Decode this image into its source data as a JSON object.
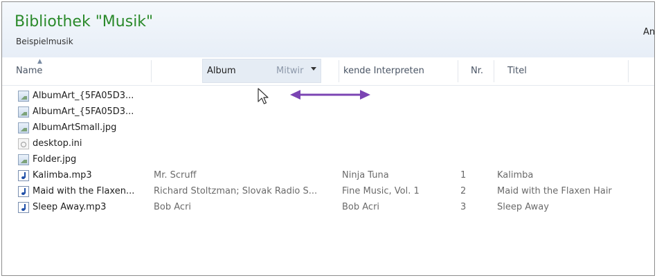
{
  "header": {
    "title": "Bibliothek \"Musik\"",
    "subtitle": "Beispielmusik",
    "arrange_cut": "An"
  },
  "columns": {
    "name": "Name",
    "album": "Album",
    "mitwirkende_partial": "Mitwir",
    "mitwirkende_rest": "kende Interpreten",
    "nr": "Nr.",
    "titel": "Titel"
  },
  "files": [
    {
      "name": "AlbumArt_{5FA05D3...",
      "icon": "image-file-icon",
      "artist": "",
      "album": "",
      "nr": "",
      "title": ""
    },
    {
      "name": "AlbumArt_{5FA05D3...",
      "icon": "image-file-icon",
      "artist": "",
      "album": "",
      "nr": "",
      "title": ""
    },
    {
      "name": "AlbumArtSmall.jpg",
      "icon": "image-file-icon",
      "artist": "",
      "album": "",
      "nr": "",
      "title": ""
    },
    {
      "name": "desktop.ini",
      "icon": "settings-file-icon",
      "artist": "",
      "album": "",
      "nr": "",
      "title": ""
    },
    {
      "name": "Folder.jpg",
      "icon": "image-file-icon",
      "artist": "",
      "album": "",
      "nr": "",
      "title": ""
    },
    {
      "name": "Kalimba.mp3",
      "icon": "audio-file-icon",
      "artist": "Mr. Scruff",
      "album": "Ninja Tuna",
      "nr": "1",
      "title": "Kalimba"
    },
    {
      "name": "Maid with the Flaxen...",
      "icon": "audio-file-icon",
      "artist": "Richard Stoltzman; Slovak Radio S...",
      "album": "Fine Music, Vol. 1",
      "nr": "2",
      "title": "Maid with the Flaxen Hair"
    },
    {
      "name": "Sleep Away.mp3",
      "icon": "audio-file-icon",
      "artist": "Bob Acri",
      "album": "Bob Acri",
      "nr": "3",
      "title": "Sleep Away"
    }
  ],
  "colors": {
    "title_green": "#2b8a2b",
    "annotation_arrow": "#7b44b3"
  }
}
